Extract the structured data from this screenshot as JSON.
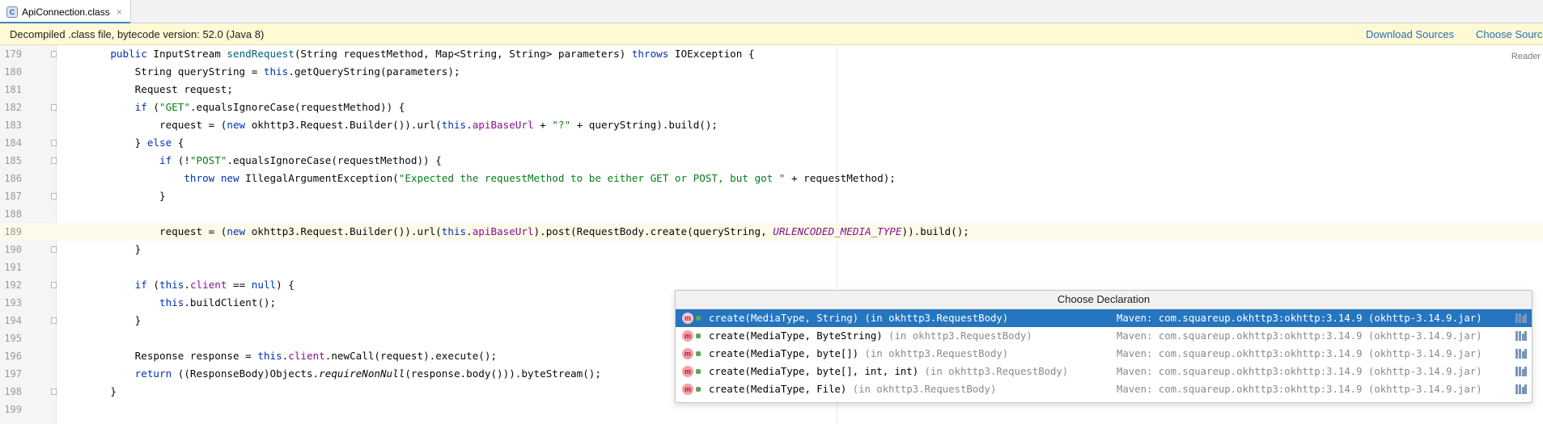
{
  "tab": {
    "icon": "class-file-icon",
    "icon_letter": "C",
    "label": "ApiConnection.class",
    "close": "×"
  },
  "banner": {
    "text": "Decompiled .class file, bytecode version: 52.0 (Java 8)",
    "download_sources": "Download Sources",
    "choose_sources": "Choose Sources..."
  },
  "editor": {
    "reader_mode": "Reader",
    "current_line": 189,
    "lines": [
      {
        "n": "179",
        "code": "    public InputStream sendRequest(String requestMethod, Map<String, String> parameters) throws IOException {"
      },
      {
        "n": "180",
        "code": "        String queryString = this.getQueryString(parameters);"
      },
      {
        "n": "181",
        "code": "        Request request;"
      },
      {
        "n": "182",
        "code": "        if (\"GET\".equalsIgnoreCase(requestMethod)) {"
      },
      {
        "n": "183",
        "code": "            request = (new okhttp3.Request.Builder()).url(this.apiBaseUrl + \"?\" + queryString).build();"
      },
      {
        "n": "184",
        "code": "        } else {"
      },
      {
        "n": "185",
        "code": "            if (!\"POST\".equalsIgnoreCase(requestMethod)) {"
      },
      {
        "n": "186",
        "code": "                throw new IllegalArgumentException(\"Expected the requestMethod to be either GET or POST, but got \" + requestMethod);"
      },
      {
        "n": "187",
        "code": "            }"
      },
      {
        "n": "188",
        "code": ""
      },
      {
        "n": "189",
        "code": "            request = (new okhttp3.Request.Builder()).url(this.apiBaseUrl).post(RequestBody.create(queryString, URLENCODED_MEDIA_TYPE)).build();"
      },
      {
        "n": "190",
        "code": "        }"
      },
      {
        "n": "191",
        "code": ""
      },
      {
        "n": "192",
        "code": "        if (this.client == null) {"
      },
      {
        "n": "193",
        "code": "            this.buildClient();"
      },
      {
        "n": "194",
        "code": "        }"
      },
      {
        "n": "195",
        "code": ""
      },
      {
        "n": "196",
        "code": "        Response response = this.client.newCall(request).execute();"
      },
      {
        "n": "197",
        "code": "        return ((ResponseBody)Objects.requireNonNull(response.body())).byteStream();"
      },
      {
        "n": "198",
        "code": "    }"
      },
      {
        "n": "199",
        "code": ""
      }
    ]
  },
  "popup": {
    "title": "Choose Declaration",
    "items": [
      {
        "icon_letter": "m",
        "sig": "create(MediaType, String)",
        "loc": "(in okhttp3.RequestBody)",
        "maven": "Maven: com.squareup.okhttp3:okhttp:3.14.9 (okhttp-3.14.9.jar)",
        "selected": true
      },
      {
        "icon_letter": "m",
        "sig": "create(MediaType, ByteString)",
        "loc": "(in okhttp3.RequestBody)",
        "maven": "Maven: com.squareup.okhttp3:okhttp:3.14.9 (okhttp-3.14.9.jar)",
        "selected": false
      },
      {
        "icon_letter": "m",
        "sig": "create(MediaType, byte[])",
        "loc": "(in okhttp3.RequestBody)",
        "maven": "Maven: com.squareup.okhttp3:okhttp:3.14.9 (okhttp-3.14.9.jar)",
        "selected": false
      },
      {
        "icon_letter": "m",
        "sig": "create(MediaType, byte[], int, int)",
        "loc": "(in okhttp3.RequestBody)",
        "maven": "Maven: com.squareup.okhttp3:okhttp:3.14.9 (okhttp-3.14.9.jar)",
        "selected": false
      },
      {
        "icon_letter": "m",
        "sig": "create(MediaType, File)",
        "loc": "(in okhttp3.RequestBody)",
        "maven": "Maven: com.squareup.okhttp3:okhttp:3.14.9 (okhttp-3.14.9.jar)",
        "selected": false
      }
    ]
  }
}
